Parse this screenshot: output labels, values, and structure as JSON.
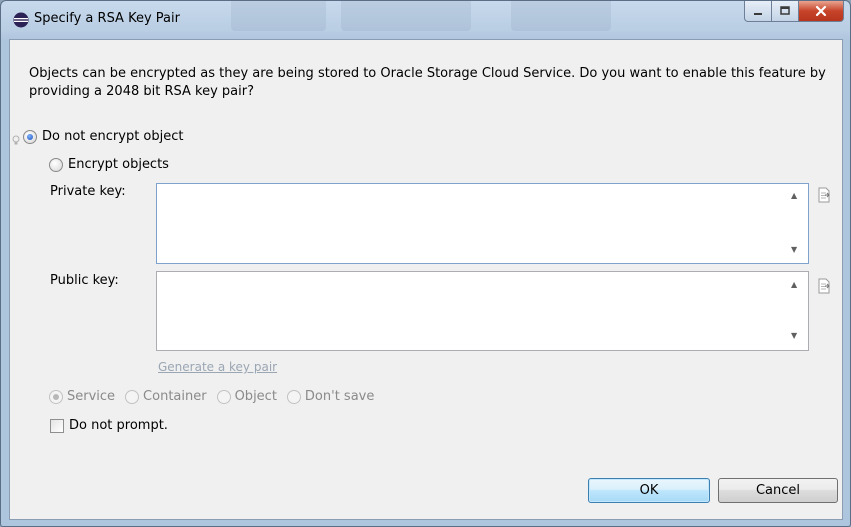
{
  "window": {
    "title": "Specify a RSA Key Pair",
    "controls": {
      "minimize": "minimize",
      "maximize": "maximize",
      "close": "close"
    }
  },
  "description": "Objects can be encrypted as they are being stored to Oracle Storage Cloud Service. Do you want to enable this feature by providing a 2048 bit RSA key pair?",
  "encryption": {
    "options": [
      {
        "label": "Do not encrypt object",
        "selected": true
      },
      {
        "label": "Encrypt objects",
        "selected": false
      }
    ]
  },
  "private_key": {
    "label": "Private key:",
    "value": ""
  },
  "public_key": {
    "label": "Public key:",
    "value": ""
  },
  "generate_link": "Generate a key pair",
  "save_scope": {
    "enabled": false,
    "options": [
      {
        "label": "Service",
        "selected": true
      },
      {
        "label": "Container",
        "selected": false
      },
      {
        "label": "Object",
        "selected": false
      },
      {
        "label": "Don't save",
        "selected": false
      }
    ]
  },
  "do_not_prompt": {
    "label": "Do not prompt.",
    "checked": false
  },
  "buttons": {
    "ok": "OK",
    "cancel": "Cancel"
  },
  "icons": {
    "app": "eclipse-icon",
    "hint": "lightbulb-icon",
    "scroll_up": "scroll-up-arrow-icon",
    "scroll_down": "scroll-down-arrow-icon",
    "file_browse": "file-import-icon"
  },
  "colors": {
    "title_bar": "#b9cde3",
    "close_button": "#c7442a",
    "ok_border": "#3c7fb1",
    "link": "#9aa6b3"
  }
}
